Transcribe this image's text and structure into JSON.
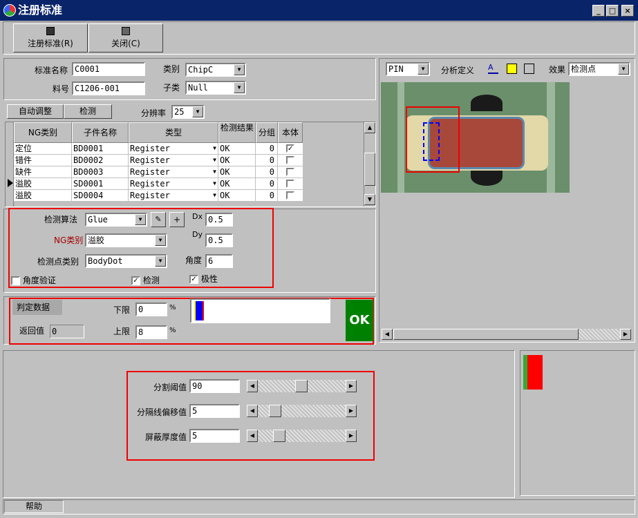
{
  "window": {
    "title": "注册标准"
  },
  "toolbar": {
    "register_label": "注册标准(R)",
    "close_label": "关闭(C)"
  },
  "info": {
    "std_name_label": "标准名称",
    "std_name_value": "C0001",
    "part_no_label": "料号",
    "part_no_value": "C1206-001",
    "category_label": "类别",
    "category_value": "ChipC",
    "subcategory_label": "子类",
    "subcategory_value": "Null"
  },
  "actions": {
    "auto_adjust": "自动调整",
    "detect": "检测",
    "resolution_label": "分辨率",
    "resolution_value": "25"
  },
  "table": {
    "headers": [
      "NG类别",
      "子件名称",
      "类型",
      "检测结果",
      "分组",
      "本体"
    ],
    "rows": [
      {
        "ng": "定位",
        "name": "BD0001",
        "type": "Register",
        "result": "OK",
        "group": "0",
        "body": true
      },
      {
        "ng": "错件",
        "name": "BD0002",
        "type": "Register",
        "result": "OK",
        "group": "0",
        "body": false
      },
      {
        "ng": "缺件",
        "name": "BD0003",
        "type": "Register",
        "result": "OK",
        "group": "0",
        "body": false
      },
      {
        "ng": "溢胶",
        "name": "SD0001",
        "type": "Register",
        "result": "OK",
        "group": "0",
        "body": false
      },
      {
        "ng": "溢胶",
        "name": "SD0004",
        "type": "Register",
        "result": "OK",
        "group": "0",
        "body": false
      }
    ]
  },
  "algo": {
    "method_label": "检测算法",
    "method_value": "Glue",
    "ng_label": "NG类别",
    "ng_value": "溢胶",
    "point_label": "检测点类别",
    "point_value": "BodyDot",
    "dx_label": "Dx",
    "dx_value": "0.5",
    "dy_label": "Dy",
    "dy_value": "0.5",
    "angle_label": "角度",
    "angle_value": "6",
    "angle_verify_label": "角度验证",
    "angle_verify": false,
    "detect_label": "检测",
    "detect": true,
    "polarity_label": "极性",
    "polarity": true
  },
  "judge": {
    "title": "判定数据",
    "lower_label": "下限",
    "lower_value": "0",
    "upper_label": "上限",
    "upper_value": "8",
    "percent": "%",
    "return_label": "返回值",
    "return_value": "0",
    "result": "OK"
  },
  "view": {
    "pin_value": "PIN",
    "analysis_label": "分析定义",
    "effect_label": "效果",
    "effect_value": "检测点"
  },
  "params": [
    {
      "label": "分割阈值",
      "value": "90"
    },
    {
      "label": "分隔线偏移值",
      "value": "5"
    },
    {
      "label": "屏蔽厚度值",
      "value": "5"
    }
  ],
  "status": {
    "help": "帮助"
  },
  "colors": {
    "ok_green": "#008000",
    "title_blue": "#0a246a",
    "highlight_red": "#e00000"
  }
}
